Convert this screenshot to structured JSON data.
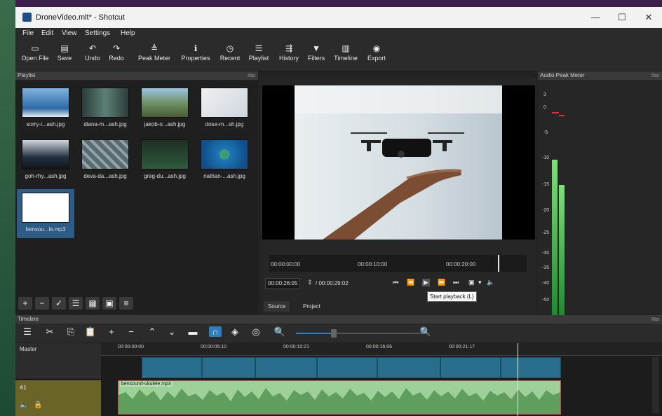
{
  "window": {
    "title": "DroneVideo.mlt* - Shotcut",
    "min": "—",
    "max": "☐",
    "close": "✕"
  },
  "menu": [
    "File",
    "Edit",
    "View",
    "Settings",
    "Help"
  ],
  "toolbar": [
    {
      "label": "Open File",
      "icon": "folder-icon",
      "glyph": "▭"
    },
    {
      "label": "Save",
      "icon": "save-icon",
      "glyph": "▤"
    },
    {
      "label": "Undo",
      "icon": "undo-icon",
      "glyph": "↶"
    },
    {
      "label": "Redo",
      "icon": "redo-icon",
      "glyph": "↷"
    },
    {
      "label": "Peak Meter",
      "icon": "meter-icon",
      "glyph": "≜"
    },
    {
      "label": "Properties",
      "icon": "info-icon",
      "glyph": "ℹ"
    },
    {
      "label": "Recent",
      "icon": "clock-icon",
      "glyph": "◷"
    },
    {
      "label": "Playlist",
      "icon": "list-icon",
      "glyph": "☰"
    },
    {
      "label": "History",
      "icon": "history-icon",
      "glyph": "⇶"
    },
    {
      "label": "Filters",
      "icon": "filter-icon",
      "glyph": "▼"
    },
    {
      "label": "Timeline",
      "icon": "timeline-icon",
      "glyph": "▥"
    },
    {
      "label": "Export",
      "icon": "export-icon",
      "glyph": "◉"
    }
  ],
  "playlist": {
    "title": "Playlist",
    "items": [
      {
        "label": "sorry-i...ash.jpg"
      },
      {
        "label": "diana-m...ash.jpg"
      },
      {
        "label": "jakob-o...ash.jpg"
      },
      {
        "label": "dose-m...sh.jpg"
      },
      {
        "label": "goh-rhy...ash.jpg"
      },
      {
        "label": "deva-da...ash.jpg"
      },
      {
        "label": "greg-du...ash.jpg"
      },
      {
        "label": "nathan-...ash.jpg"
      },
      {
        "label": "bensou...le.mp3"
      }
    ]
  },
  "viewer": {
    "ruler": [
      "00:00:00:00",
      "00:00:10:00",
      "00:00:20:00"
    ],
    "position": "00:00:26:05",
    "duration": "/ 00:00:29:02",
    "tooltip": "Start playback (L)",
    "tabs": [
      "Source",
      "Project"
    ]
  },
  "audio_meter": {
    "title": "Audio Peak Meter",
    "scale": [
      "3",
      "0",
      "-5",
      "-10",
      "-15",
      "-20",
      "-25",
      "-30",
      "-35",
      "-40",
      "-50"
    ]
  },
  "timeline": {
    "title": "Timeline",
    "ticks": [
      "00:00:00:00",
      "00:00:05:10",
      "00:00:10:21",
      "00:00:16:06",
      "00:00:21:17"
    ],
    "tracks": [
      {
        "name": "Master"
      },
      {
        "name": "A1",
        "clip": "bensound-ukulele.mp3"
      }
    ]
  }
}
